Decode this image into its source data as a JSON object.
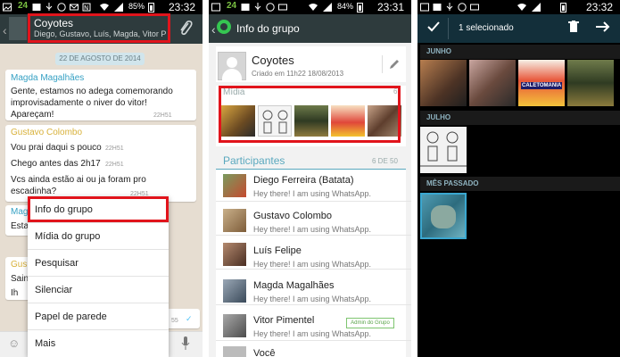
{
  "panel1": {
    "status": {
      "carrier": "24",
      "battery": "85%",
      "time": "23:32"
    },
    "chat": {
      "title": "Coyotes",
      "members": "Diego, Gustavo, Luís, Magda, Vitor Pim"
    },
    "date_divider": "22 DE AGOSTO DE 2014",
    "messages": [
      {
        "sender": "Magda Magalhães",
        "sender_color": "#36a1c4",
        "text": "Gente, estamos no adega comemorando improvisadamente o niver do vitor! Apareçam!",
        "time": "22H51"
      },
      {
        "sender": "Gustavo Colombo",
        "sender_color": "#d8b13a",
        "text": "Vou prai daqui s pouco",
        "time": "22H51"
      },
      {
        "sender": "",
        "sender_color": "",
        "text": "Chego antes das 2h17",
        "time": "22H51"
      },
      {
        "sender": "",
        "sender_color": "",
        "text": "Vcs ainda estão ai ou ja foram pro escadinha?",
        "time": "22H51"
      }
    ],
    "partial_texts": [
      "Mag",
      "Estar",
      "Gus",
      "Saind",
      "Ih"
    ],
    "partial_time": "55",
    "menu": {
      "items": [
        "Info do grupo",
        "Mídia do grupo",
        "Pesquisar",
        "Silenciar",
        "Papel de parede",
        "Mais"
      ]
    }
  },
  "panel2": {
    "status": {
      "carrier": "24",
      "battery": "84%",
      "time": "23:31"
    },
    "title": "Info do grupo",
    "group": {
      "name": "Coyotes",
      "created": "Criado em 11h22 18/08/2013"
    },
    "media": {
      "label": "Mídia",
      "count": "6"
    },
    "participants": {
      "label": "Participantes",
      "count": "6 DE 50",
      "items": [
        {
          "name": "Diego Ferreira (Batata)",
          "status": "Hey there! I am using WhatsApp."
        },
        {
          "name": "Gustavo Colombo",
          "status": "Hey there! I am using WhatsApp."
        },
        {
          "name": "Luís Felipe",
          "status": "Hey there! I am using WhatsApp."
        },
        {
          "name": "Magda Magalhães",
          "status": "Hey there! I am using WhatsApp."
        },
        {
          "name": "Vitor Pimentel",
          "status": "Hey there! I am using WhatsApp.",
          "badge": "Admin do Grupo"
        },
        {
          "name": "Você",
          "status": ""
        }
      ]
    }
  },
  "panel3": {
    "status": {
      "time": "23:32"
    },
    "selection_title": "1 selecionado",
    "sections": [
      "JUNHO",
      "JULHO",
      "MÊS PASSADO"
    ],
    "thumb_caption": "CALETOMANIA"
  }
}
